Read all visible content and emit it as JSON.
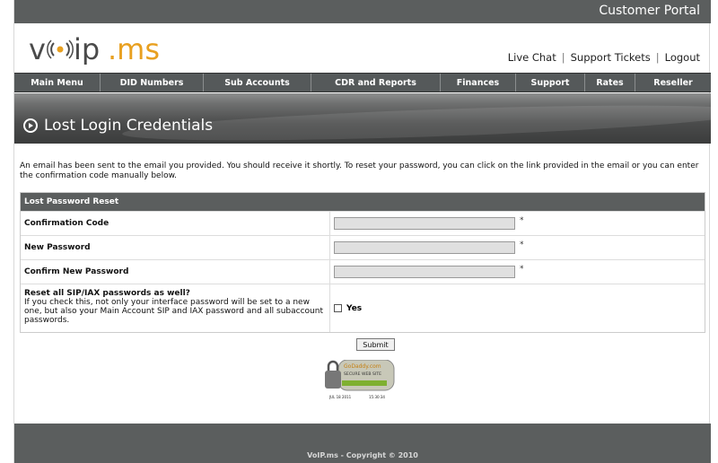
{
  "header": {
    "portal_title": "Customer Portal",
    "logo_text": "voip.ms",
    "links": [
      "Live Chat",
      "Support Tickets",
      "Logout"
    ]
  },
  "nav": {
    "items": [
      {
        "label": "Main Menu"
      },
      {
        "label": "DID Numbers"
      },
      {
        "label": "Sub Accounts"
      },
      {
        "label": "CDR and Reports"
      },
      {
        "label": "Finances"
      },
      {
        "label": "Support"
      },
      {
        "label": "Rates"
      },
      {
        "label": "Reseller"
      }
    ]
  },
  "banner": {
    "title": "Lost Login Credentials"
  },
  "message": "An email has been sent to the email you provided. You should receive it shortly. To reset your password, you can click on the link provided in the email or you can enter the confirmation code manually below.",
  "form": {
    "heading": "Lost Password Reset",
    "fields": [
      {
        "label": "Confirmation Code",
        "value": "",
        "required": "*"
      },
      {
        "label": "New Password",
        "value": "",
        "required": "*"
      },
      {
        "label": "Confirm New Password",
        "value": "",
        "required": "*"
      }
    ],
    "reset_all": {
      "label": "Reset all SIP/IAX passwords as well?",
      "description": "If you check this, not only your interface password will be set to a new one, but also your Main Account SIP and IAX password and all subaccount passwords.",
      "checkbox_label": "Yes",
      "checked": false
    },
    "submit_label": "Submit"
  },
  "seal": {
    "brand": "GoDaddy.com",
    "caption": "SECURE WEB SITE",
    "date": "JUL 18 2011",
    "time": "15:30:34"
  },
  "footer": {
    "copyright": "VoIP.ms - Copyright © 2010"
  },
  "colors": {
    "header_bar": "#5b5e5e",
    "nav_bar": "#55595a",
    "logo_dark": "#4a4a4a",
    "logo_accent": "#e8a020"
  }
}
